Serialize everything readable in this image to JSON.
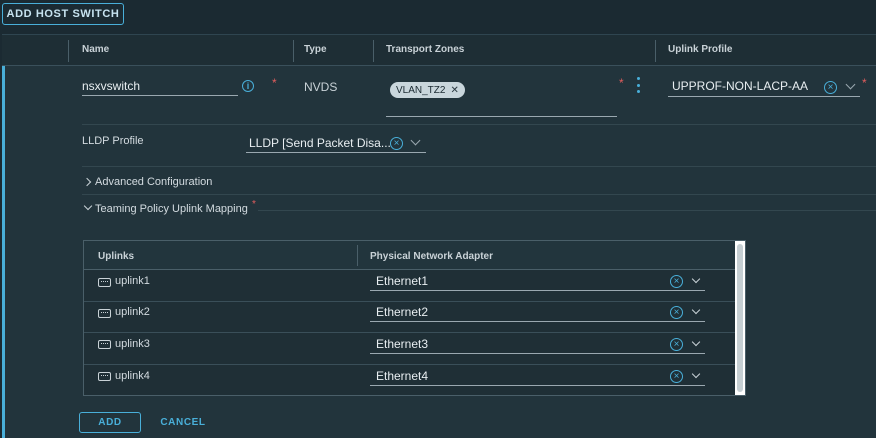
{
  "toolbar": {
    "add_host_switch_label": "ADD HOST SWITCH"
  },
  "columns": {
    "name": "Name",
    "type": "Type",
    "transport_zones": "Transport Zones",
    "uplink_profile": "Uplink Profile"
  },
  "switch": {
    "name_value": "nsxvswitch",
    "type_value": "NVDS",
    "transport_zone_tag": "VLAN_TZ2",
    "uplink_profile_value": "UPPROF-NON-LACP-AA"
  },
  "lldp": {
    "label": "LLDP Profile",
    "value": "LLDP [Send Packet Disa..."
  },
  "sections": {
    "advanced_configuration": "Advanced Configuration",
    "teaming_policy": "Teaming Policy Uplink Mapping"
  },
  "mapping_table": {
    "headers": [
      "Uplinks",
      "Physical Network Adapter"
    ],
    "rows": [
      {
        "uplink": "uplink1",
        "adapter": "Ethernet1"
      },
      {
        "uplink": "uplink2",
        "adapter": "Ethernet2"
      },
      {
        "uplink": "uplink3",
        "adapter": "Ethernet3"
      },
      {
        "uplink": "uplink4",
        "adapter": "Ethernet4"
      }
    ]
  },
  "actions": {
    "add_label": "ADD",
    "cancel_label": "CANCEL"
  },
  "icons": {
    "info": "info-icon",
    "clear": "clear-icon",
    "chevron": "chevron-down-icon",
    "kebab": "more-vertical-icon",
    "uplink": "uplink-port-icon"
  },
  "colors": {
    "accent": "#49afd9",
    "required": "#e25d5d",
    "background": "#1b2a32"
  },
  "required_marker": "*"
}
